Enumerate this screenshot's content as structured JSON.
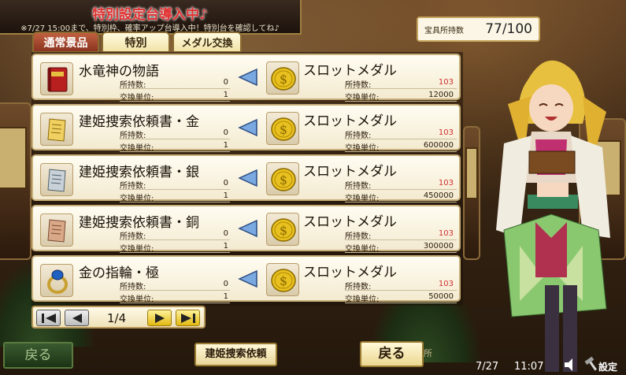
{
  "banner": {
    "title": "特別設定台導入中♪",
    "subtitle": "※7/27 15:00まで、特別枠、確率アップ台導入中！特別台を確認してね♪"
  },
  "currency": {
    "label": "宝具所持数",
    "value": "77/100"
  },
  "tabs": [
    {
      "label": "通常景品",
      "active": true
    },
    {
      "label": "特別",
      "active": false
    },
    {
      "label": "メダル交換",
      "active": false
    }
  ],
  "row_labels": {
    "owned": "所持数:",
    "unit": "交換単位:"
  },
  "items": [
    {
      "name": "水竜神の物語",
      "owned": "0",
      "unit": "1",
      "icon": "red-book-icon",
      "reward": "スロットメダル",
      "reward_owned": "103",
      "reward_unit": "12000"
    },
    {
      "name": "建姫捜索依頼書・金",
      "owned": "0",
      "unit": "1",
      "icon": "gold-scroll-icon",
      "reward": "スロットメダル",
      "reward_owned": "103",
      "reward_unit": "600000"
    },
    {
      "name": "建姫捜索依頼書・銀",
      "owned": "0",
      "unit": "1",
      "icon": "silver-scroll-icon",
      "reward": "スロットメダル",
      "reward_owned": "103",
      "reward_unit": "450000"
    },
    {
      "name": "建姫捜索依頼書・銅",
      "owned": "0",
      "unit": "1",
      "icon": "bronze-scroll-icon",
      "reward": "スロットメダル",
      "reward_owned": "103",
      "reward_unit": "300000"
    },
    {
      "name": "金の指輪・極",
      "owned": "0",
      "unit": "1",
      "icon": "gold-ring-icon",
      "reward": "スロットメダル",
      "reward_owned": "103",
      "reward_unit": "50000"
    }
  ],
  "pager": {
    "text": "1/4"
  },
  "buttons": {
    "back_left": "戻る",
    "request": "建姫捜索依頼",
    "back_center": "戻る",
    "place": "所"
  },
  "status": {
    "date": "7/27",
    "time": "11:07",
    "settings": "設定"
  },
  "colors": {
    "accent_red": "#d03030",
    "panel": "#fffdf2",
    "gold": "#e2b810"
  }
}
